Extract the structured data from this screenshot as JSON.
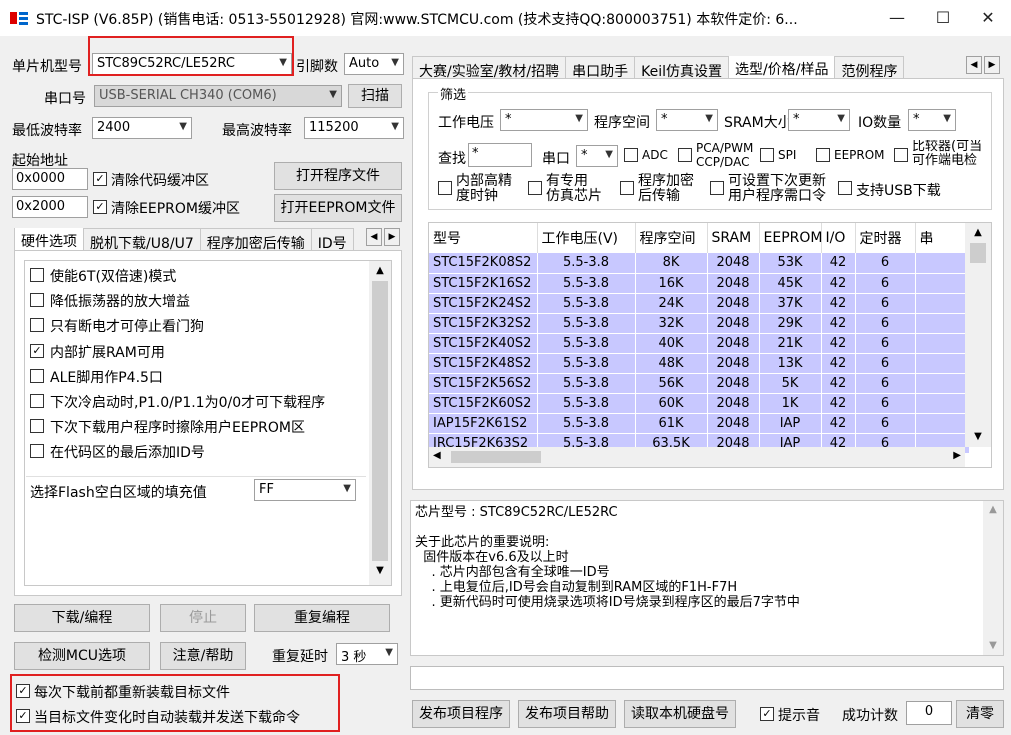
{
  "window": {
    "title": "STC-ISP (V6.85P) (销售电话: 0513-55012928) 官网:www.STCMCU.com (技术支持QQ:800003751) 本软件定价: 6..."
  },
  "mcu": {
    "label": "单片机型号",
    "value": "STC89C52RC/LE52RC",
    "pins_label": "引脚数",
    "pins_value": "Auto"
  },
  "port": {
    "label": "串口号",
    "value": "USB-SERIAL CH340 (COM6)",
    "scan": "扫描"
  },
  "baud": {
    "min_label": "最低波特率",
    "min_value": "2400",
    "max_label": "最高波特率",
    "max_value": "115200"
  },
  "start": {
    "label": "起始地址",
    "addr1": "0x0000",
    "clear_code": "清除代码缓冲区",
    "open_prog": "打开程序文件",
    "addr2": "0x2000",
    "clear_eeprom": "清除EEPROM缓冲区",
    "open_eeprom": "打开EEPROM文件"
  },
  "left_tabs": [
    "硬件选项",
    "脱机下载/U8/U7",
    "程序加密后传输",
    "ID号"
  ],
  "options": [
    {
      "label": "使能6T(双倍速)模式",
      "checked": false
    },
    {
      "label": "降低振荡器的放大增益",
      "checked": false
    },
    {
      "label": "只有断电才可停止看门狗",
      "checked": false
    },
    {
      "label": "内部扩展RAM可用",
      "checked": true
    },
    {
      "label": "ALE脚用作P4.5口",
      "checked": false
    },
    {
      "label": "下次冷启动时,P1.0/P1.1为0/0才可下载程序",
      "checked": false
    },
    {
      "label": "下次下载用户程序时擦除用户EEPROM区",
      "checked": false
    },
    {
      "label": "在代码区的最后添加ID号",
      "checked": false
    }
  ],
  "fill": {
    "label": "选择Flash空白区域的填充值",
    "value": "FF"
  },
  "actions": {
    "download": "下载/编程",
    "stop": "停止",
    "reprogram": "重复编程",
    "detect": "检测MCU选项",
    "help": "注意/帮助",
    "delay_label": "重复延时",
    "delay_value": "3 秒"
  },
  "bottom_checks": [
    {
      "label": "每次下载前都重新装载目标文件",
      "checked": true
    },
    {
      "label": "当目标文件变化时自动装载并发送下载命令",
      "checked": true
    }
  ],
  "right_tabs": [
    "大赛/实验室/教材/招聘",
    "串口助手",
    "Keil仿真设置",
    "选型/价格/样品",
    "范例程序"
  ],
  "filter": {
    "group": "筛选",
    "voltage_label": "工作电压",
    "voltage_value": "*",
    "prog_label": "程序空间",
    "prog_value": "*",
    "sram_label": "SRAM大小",
    "sram_value": "*",
    "io_label": "IO数量",
    "io_value": "*",
    "search_label": "查找",
    "search_value": "*",
    "uart_label": "串口",
    "uart_value": "*",
    "adc": "ADC",
    "pca": "PCA/PWM\nCCP/DAC",
    "spi": "SPI",
    "eeprom": "EEPROM",
    "comparator": "比较器(可当\n可作端电检",
    "highprec": "内部高精\n度时钟",
    "dedicated": "有专用\n仿真芯片",
    "encrypt": "程序加密\n后传输",
    "settable": "可设置下次更新\n用户程序需口令",
    "usb": "支持USB下载"
  },
  "table": {
    "headers": [
      "型号",
      "工作电压(V)",
      "程序空间",
      "SRAM",
      "EEPROM",
      "I/O",
      "定时器",
      "串"
    ],
    "rows": [
      [
        "STC15F2K08S2",
        "5.5-3.8",
        "8K",
        "2048",
        "53K",
        "42",
        "6"
      ],
      [
        "STC15F2K16S2",
        "5.5-3.8",
        "16K",
        "2048",
        "45K",
        "42",
        "6"
      ],
      [
        "STC15F2K24S2",
        "5.5-3.8",
        "24K",
        "2048",
        "37K",
        "42",
        "6"
      ],
      [
        "STC15F2K32S2",
        "5.5-3.8",
        "32K",
        "2048",
        "29K",
        "42",
        "6"
      ],
      [
        "STC15F2K40S2",
        "5.5-3.8",
        "40K",
        "2048",
        "21K",
        "42",
        "6"
      ],
      [
        "STC15F2K48S2",
        "5.5-3.8",
        "48K",
        "2048",
        "13K",
        "42",
        "6"
      ],
      [
        "STC15F2K56S2",
        "5.5-3.8",
        "56K",
        "2048",
        "5K",
        "42",
        "6"
      ],
      [
        "STC15F2K60S2",
        "5.5-3.8",
        "60K",
        "2048",
        "1K",
        "42",
        "6"
      ],
      [
        "IAP15F2K61S2",
        "5.5-3.8",
        "61K",
        "2048",
        "IAP",
        "42",
        "6"
      ],
      [
        "IRC15F2K63S2",
        "5.5-3.8",
        "63.5K",
        "2048",
        "IAP",
        "42",
        "6"
      ]
    ]
  },
  "info": {
    "chip_line": "芯片型号 : STC89C52RC/LE52RC",
    "text": "关于此芯片的重要说明:\n  固件版本在v6.6及以上时\n    . 芯片内部包含有全球唯一ID号\n    . 上电复位后,ID号会自动复制到RAM区域的F1H-F7H\n    . 更新代码时可使用烧录选项将ID号烧录到程序区的最后7字节中"
  },
  "footer": {
    "publish": "发布项目程序",
    "publish_help": "发布项目帮助",
    "read_disk": "读取本机硬盘号",
    "beep": "提示音",
    "beep_checked": true,
    "count_label": "成功计数",
    "count_value": "0",
    "clear": "清零"
  }
}
